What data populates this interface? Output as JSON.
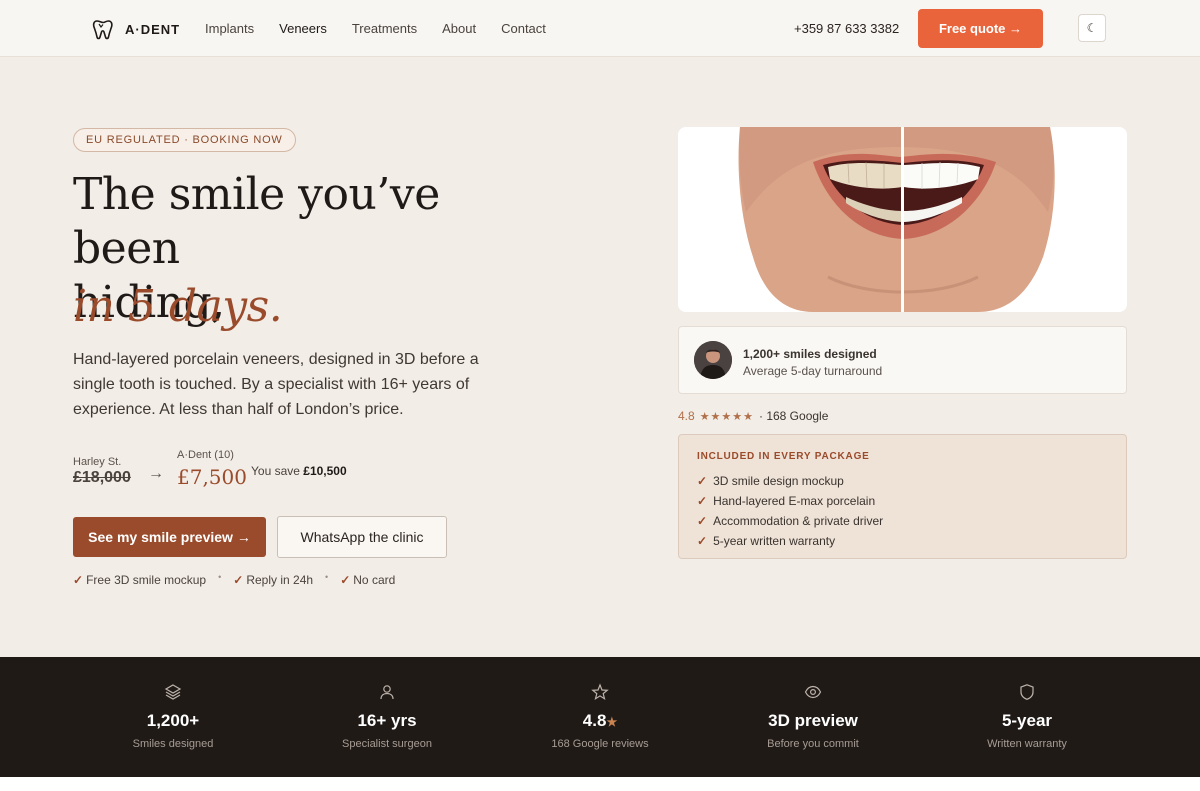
{
  "nav": {
    "logo_text": "A·DENT",
    "links": [
      "Implants",
      "Veneers",
      "Treatments",
      "About",
      "Contact"
    ],
    "active_link": "Veneers",
    "phone": "+359 87 633 3382",
    "quote_label": "Free quote →",
    "theme_icon": "moon-icon"
  },
  "hero": {
    "badge": "EU REGULATED · BOOKING NOW",
    "headline_line1": "The smile you’ve been",
    "headline_line2": "hiding,",
    "headline_accent": "in 5 days.",
    "lead": "Hand-layered porcelain veneers, designed in 3D before a single tooth is touched. By a specialist with 16+ years of experience. At less than half of London’s price.",
    "price": {
      "old_label": "Harley St.",
      "old_price": "£18,000",
      "arrow": "→",
      "new_label": "A·Dent (10)",
      "new_price": "£7,500",
      "save_prefix": "You save",
      "save_amount": "£10,500"
    },
    "primary_cta": "See my smile preview →",
    "secondary_cta": "WhatsApp the clinic",
    "perks": [
      "Free 3D smile mockup",
      "Reply in 24h",
      "No card"
    ]
  },
  "proof": {
    "title": "1,200+ smiles designed",
    "subtitle": "Average 5-day turnaround",
    "rating_score": "4.8",
    "rating_stars": "★★★★★",
    "rating_count": "· 168 Google"
  },
  "included": {
    "title": "INCLUDED IN EVERY PACKAGE",
    "items": [
      "3D smile design mockup",
      "Hand-layered E-max porcelain",
      "Accommodation & private driver",
      "5-year written warranty"
    ]
  },
  "stats": [
    {
      "icon": "layers-icon",
      "value": "1,200+",
      "label": "Smiles designed"
    },
    {
      "icon": "user-icon",
      "value": "16+ yrs",
      "label": "Specialist surgeon"
    },
    {
      "icon": "star-icon",
      "value": "4.8",
      "value_suffix": "★",
      "label": "168 Google reviews"
    },
    {
      "icon": "eye-icon",
      "value": "3D preview",
      "label": "Before you commit"
    },
    {
      "icon": "shield-icon",
      "value": "5-year",
      "label": "Written warranty"
    }
  ],
  "colors": {
    "accent": "#9a4b2b",
    "cta_orange": "#e9643b",
    "hero_bg": "#f3ede7",
    "stats_bg": "#201a17"
  }
}
